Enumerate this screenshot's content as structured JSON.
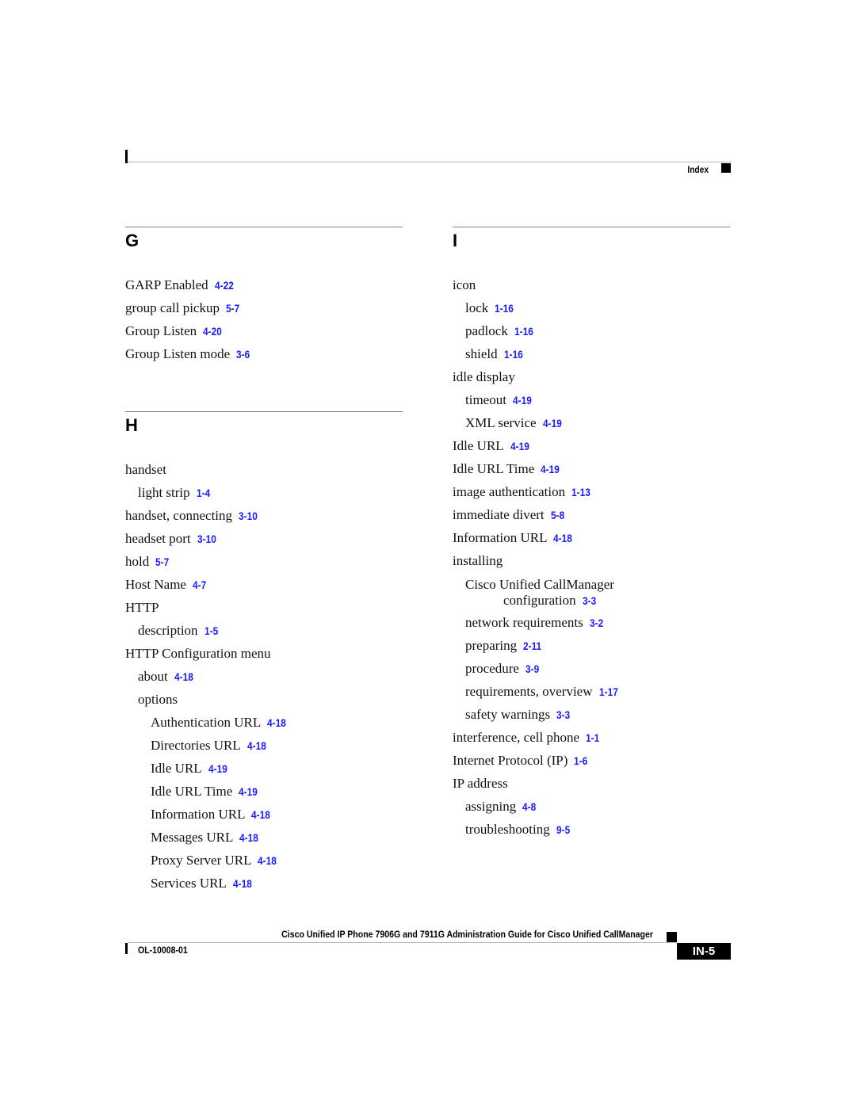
{
  "header": {
    "section_label": "Index"
  },
  "left_column": {
    "sections": [
      {
        "letter": "G",
        "entries": [
          {
            "text": "GARP Enabled",
            "ref": "4-22",
            "level": 0
          },
          {
            "text": "group call pickup",
            "ref": "5-7",
            "level": 0
          },
          {
            "text": "Group Listen",
            "ref": "4-20",
            "level": 0
          },
          {
            "text": "Group Listen mode",
            "ref": "3-6",
            "level": 0
          }
        ]
      },
      {
        "letter": "H",
        "entries": [
          {
            "text": "handset",
            "ref": null,
            "level": 0
          },
          {
            "text": "light strip",
            "ref": "1-4",
            "level": 1
          },
          {
            "text": "handset, connecting",
            "ref": "3-10",
            "level": 0
          },
          {
            "text": "headset port",
            "ref": "3-10",
            "level": 0
          },
          {
            "text": "hold",
            "ref": "5-7",
            "level": 0
          },
          {
            "text": "Host Name",
            "ref": "4-7",
            "level": 0
          },
          {
            "text": "HTTP",
            "ref": null,
            "level": 0
          },
          {
            "text": "description",
            "ref": "1-5",
            "level": 1
          },
          {
            "text": "HTTP Configuration menu",
            "ref": null,
            "level": 0
          },
          {
            "text": "about",
            "ref": "4-18",
            "level": 1
          },
          {
            "text": "options",
            "ref": null,
            "level": 1
          },
          {
            "text": "Authentication URL",
            "ref": "4-18",
            "level": 2
          },
          {
            "text": "Directories URL",
            "ref": "4-18",
            "level": 2
          },
          {
            "text": "Idle URL",
            "ref": "4-19",
            "level": 2
          },
          {
            "text": "Idle URL Time",
            "ref": "4-19",
            "level": 2
          },
          {
            "text": "Information URL",
            "ref": "4-18",
            "level": 2
          },
          {
            "text": "Messages URL",
            "ref": "4-18",
            "level": 2
          },
          {
            "text": "Proxy Server URL",
            "ref": "4-18",
            "level": 2
          },
          {
            "text": "Services URL",
            "ref": "4-18",
            "level": 2
          }
        ]
      }
    ]
  },
  "right_column": {
    "sections": [
      {
        "letter": "I",
        "entries": [
          {
            "text": "icon",
            "ref": null,
            "level": 0
          },
          {
            "text": "lock",
            "ref": "1-16",
            "level": 1
          },
          {
            "text": "padlock",
            "ref": "1-16",
            "level": 1
          },
          {
            "text": "shield",
            "ref": "1-16",
            "level": 1
          },
          {
            "text": "idle display",
            "ref": null,
            "level": 0
          },
          {
            "text": "timeout",
            "ref": "4-19",
            "level": 1
          },
          {
            "text": "XML service",
            "ref": "4-19",
            "level": 1
          },
          {
            "text": "Idle URL",
            "ref": "4-19",
            "level": 0
          },
          {
            "text": "Idle URL Time",
            "ref": "4-19",
            "level": 0
          },
          {
            "text": "image authentication",
            "ref": "1-13",
            "level": 0
          },
          {
            "text": "immediate divert",
            "ref": "5-8",
            "level": 0
          },
          {
            "text": "Information URL",
            "ref": "4-18",
            "level": 0
          },
          {
            "text": "installing",
            "ref": null,
            "level": 0
          },
          {
            "text": "Cisco Unified CallManager",
            "continuation": "configuration",
            "ref": "3-3",
            "level": 1
          },
          {
            "text": "network requirements",
            "ref": "3-2",
            "level": 1
          },
          {
            "text": "preparing",
            "ref": "2-11",
            "level": 1
          },
          {
            "text": "procedure",
            "ref": "3-9",
            "level": 1
          },
          {
            "text": "requirements, overview",
            "ref": "1-17",
            "level": 1
          },
          {
            "text": "safety warnings",
            "ref": "3-3",
            "level": 1
          },
          {
            "text": "interference, cell phone",
            "ref": "1-1",
            "level": 0
          },
          {
            "text": "Internet Protocol (IP)",
            "ref": "1-6",
            "level": 0
          },
          {
            "text": "IP address",
            "ref": null,
            "level": 0
          },
          {
            "text": "assigning",
            "ref": "4-8",
            "level": 1
          },
          {
            "text": "troubleshooting",
            "ref": "9-5",
            "level": 1
          }
        ]
      }
    ]
  },
  "footer": {
    "book_title": "Cisco Unified IP Phone 7906G and 7911G Administration Guide for Cisco Unified CallManager",
    "doc_number": "OL-10008-01",
    "page_number": "IN-5"
  },
  "colors": {
    "link": "#1a1aff",
    "text": "#111111",
    "rule": "#808080"
  }
}
